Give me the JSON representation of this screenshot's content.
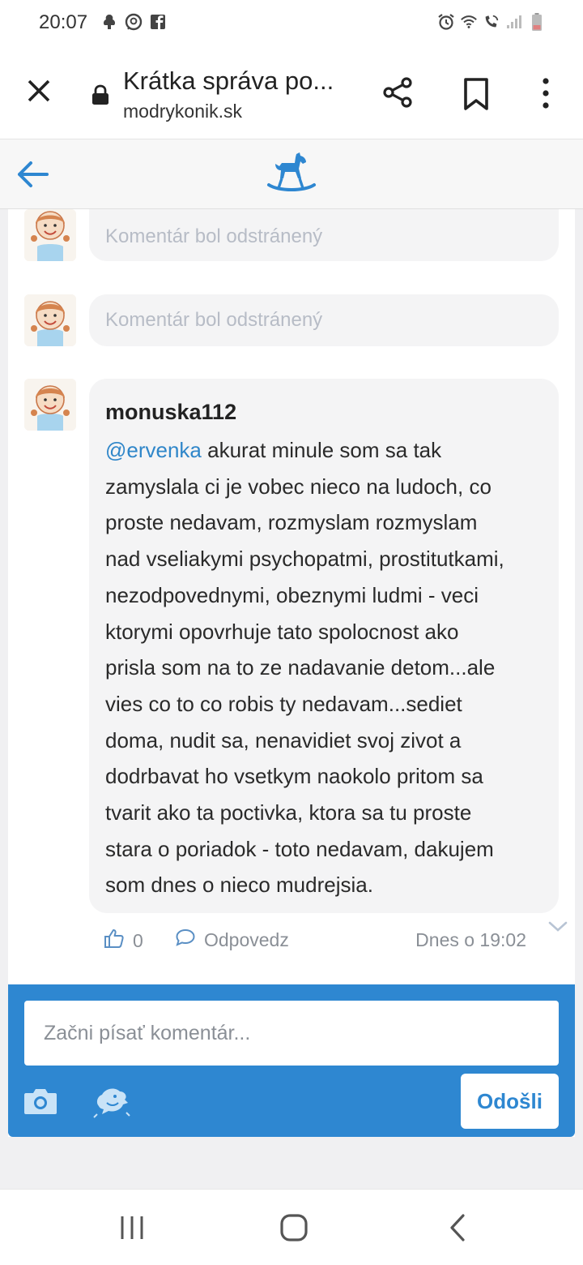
{
  "status_bar": {
    "time": "20:07",
    "left_icons": [
      "notification-icon",
      "messenger-icon",
      "facebook-icon"
    ],
    "right_icons": [
      "alarm-icon",
      "wifi-icon",
      "wifi-call-icon",
      "signal-icon",
      "battery-icon"
    ]
  },
  "browser": {
    "page_title": "Krátka správa po...",
    "domain": "modrykonik.sk",
    "icons": [
      "close-icon",
      "lock-icon",
      "share-icon",
      "bookmark-icon",
      "more-vertical-icon"
    ]
  },
  "site_header": {
    "back_icon": "arrow-left-icon",
    "logo": "rocking-horse-logo"
  },
  "comments": [
    {
      "deleted": true,
      "text": "Komentár bol odstránený"
    },
    {
      "deleted": true,
      "text": "Komentár bol odstránený"
    },
    {
      "deleted": false,
      "author": "monuska112",
      "mention": "@ervenka",
      "lines": [
        " akurat minule som sa tak",
        "zamyslala ci je vobec nieco na ludoch, co",
        "proste nedavam, rozmyslam rozmyslam",
        "nad vseliakymi psychopatmi, prostitutkami,",
        "nezodpovednymi, obeznymi ludmi - veci",
        "ktorymi opovrhuje tato spolocnost ako",
        "prisla som na to ze nadavanie detom...ale",
        "vies co to co robis ty nedavam...sediet",
        "doma, nudit sa, nenavidiet svoj zivot a",
        "dodrbavat ho vsetkym naokolo pritom sa",
        "tvarit ako ta poctivka, ktora sa tu proste",
        "stara o poriadok - toto nedavam, dakujem",
        "som dnes o nieco mudrejsia."
      ],
      "likes": "0",
      "reply_label": "Odpovedz",
      "timestamp": "Dnes o 19:02"
    }
  ],
  "composer": {
    "placeholder": "Začni písať komentár...",
    "send_label": "Odošli",
    "colors": {
      "accent": "#2e87d1"
    }
  },
  "nav_bar": {
    "icons": [
      "recents-icon",
      "home-icon",
      "back-icon"
    ]
  }
}
